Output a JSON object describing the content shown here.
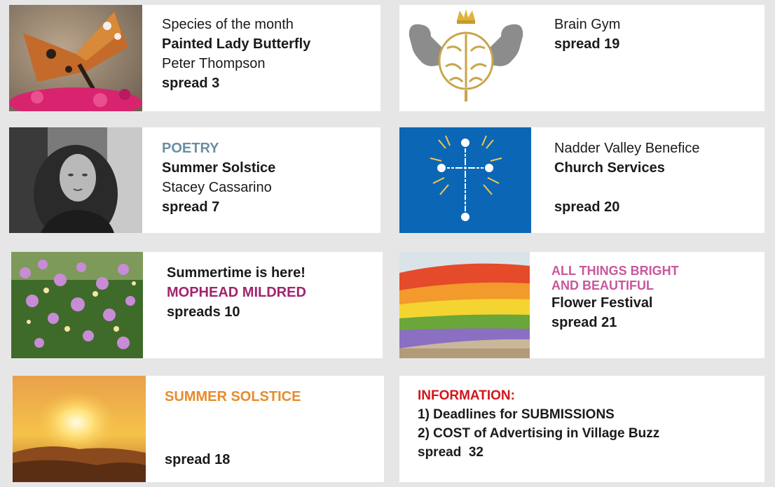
{
  "cards": {
    "butterfly": {
      "kicker": "Species of the month",
      "title": "Painted Lady Butterfly",
      "author": "Peter Thompson",
      "spread": "spread 3"
    },
    "braingym": {
      "title": "Brain Gym",
      "spread": "spread 19"
    },
    "poetry": {
      "kicker": "POETRY",
      "title": "Summer Solstice",
      "author": "Stacey Cassarino",
      "spread": "spread 7"
    },
    "church": {
      "kicker": "Nadder Valley Benefice",
      "title": "Church Services",
      "spread": "spread 20"
    },
    "mildred": {
      "kicker": "Summertime is here!",
      "title": "MOPHEAD MILDRED",
      "spread": "spreads 10"
    },
    "flower": {
      "kicker_line1": "ALL THINGS BRIGHT",
      "kicker_line2": "AND BEAUTIFUL",
      "title": "Flower Festival",
      "spread": "spread 21"
    },
    "solstice": {
      "title": "SUMMER SOLSTICE",
      "spread": "spread 18"
    },
    "information": {
      "title": "INFORMATION:",
      "item1": "1) Deadlines for SUBMISSIONS",
      "item2": "2) COST of Advertising in Village Buzz",
      "spread": "spread  32"
    }
  },
  "colors": {
    "background": "#e6e6e6",
    "card": "#ffffff",
    "poetry_kicker": "#6b8fa3",
    "mildred": "#a0246e",
    "flower_kicker": "#c9579c",
    "solstice": "#e98a2c",
    "information": "#d2161c",
    "church_panel": "#0b67b5"
  },
  "icons": [
    "butterfly-photo",
    "brain-gym-icon",
    "portrait-photo",
    "cross-icon",
    "flowers-photo",
    "flower-festival-photo",
    "sunset-photo"
  ]
}
